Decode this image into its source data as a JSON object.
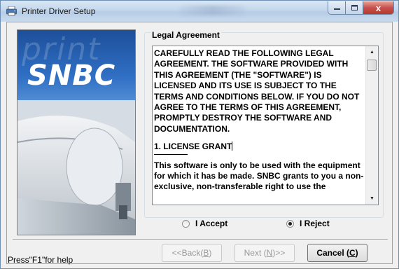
{
  "window": {
    "title": "Printer Driver Setup",
    "app_icon": "printer-setup-icon",
    "controls": [
      "minimize-icon",
      "maximize-icon",
      "close-icon"
    ],
    "close_glyph": "x"
  },
  "image_panel": {
    "logo_text": "SNBC",
    "background_text": "print"
  },
  "legal": {
    "group_label": "Legal Agreement",
    "paragraphs": [
      "CAREFULLY READ THE FOLLOWING LEGAL AGREEMENT. THE SOFTWARE PROVIDED WITH THIS AGREEMENT (THE \"SOFTWARE\") IS LICENSED AND ITS USE IS SUBJECT TO THE TERMS AND CONDITIONS BELOW. IF YOU DO NOT AGREE TO THE TERMS OF THIS AGREEMENT, PROMPTLY DESTROY THE SOFTWARE AND DOCUMENTATION.",
      "1. LICENSE GRANT",
      "This software is only to be used with the equipment for which it has be made. SNBC grants to you a non-exclusive, non-transferable right to use the"
    ],
    "scroll_up_glyph": "▲",
    "scroll_down_glyph": "▼"
  },
  "options": {
    "accept_label": "I Accept",
    "reject_label": "I Reject",
    "selected": "reject"
  },
  "footer": {
    "help_text": "Press\"F1\"for help",
    "back_label_pre": "<<Back(",
    "back_mnemonic": "B",
    "back_label_post": ")",
    "next_label_pre": "Next (",
    "next_mnemonic": "N",
    "next_label_post": ")>>",
    "cancel_label_pre": "Cancel (",
    "cancel_mnemonic": "C",
    "cancel_label_post": ")"
  },
  "colors": {
    "window_bg": "#f0f0f0",
    "titlebar": "#c3d7ec",
    "close_button": "#c75050",
    "logo_band": "#2f6fc4"
  }
}
